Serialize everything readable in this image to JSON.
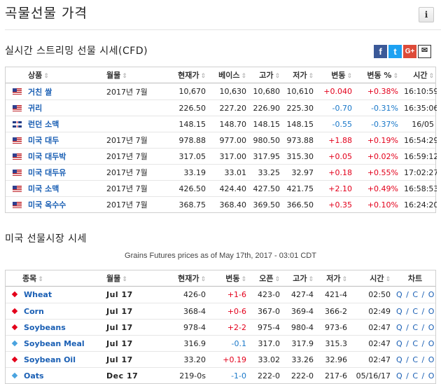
{
  "page": {
    "title": "곡물선물 가격",
    "info_label": "i"
  },
  "cfd": {
    "title": "실시간 스트리밍 선물 시세(CFD)",
    "share_icons": [
      "facebook-icon",
      "twitter-icon",
      "google-plus-icon",
      "email-icon"
    ],
    "share_glyphs": {
      "facebook": "f",
      "twitter": "t",
      "google": "G+",
      "email": "✉"
    },
    "columns": [
      "상품",
      "월물",
      "현재가",
      "베이스",
      "고가",
      "저가",
      "변동",
      "변동 %",
      "시간"
    ],
    "rows": [
      {
        "flag": "us",
        "name": "거친 쌀",
        "month": "2017년 7월",
        "last": "10,670",
        "base": "10,630",
        "high": "10,680",
        "low": "10,610",
        "chg": "+0.040",
        "pct": "+0.38%",
        "time": "16:10:59",
        "dir": "up"
      },
      {
        "flag": "us",
        "name": "귀리",
        "month": "",
        "last": "226.50",
        "base": "227.20",
        "high": "226.90",
        "low": "225.30",
        "chg": "-0.70",
        "pct": "-0.31%",
        "time": "16:35:06",
        "dir": "down"
      },
      {
        "flag": "uk",
        "name": "런던 소맥",
        "month": "",
        "last": "148.15",
        "base": "148.70",
        "high": "148.15",
        "low": "148.15",
        "chg": "-0.55",
        "pct": "-0.37%",
        "time": "16/05",
        "dir": "down"
      },
      {
        "flag": "us",
        "name": "미국 대두",
        "month": "2017년 7월",
        "last": "978.88",
        "base": "977.00",
        "high": "980.50",
        "low": "973.88",
        "chg": "+1.88",
        "pct": "+0.19%",
        "time": "16:54:29",
        "dir": "up"
      },
      {
        "flag": "us",
        "name": "미국 대두박",
        "month": "2017년 7월",
        "last": "317.05",
        "base": "317.00",
        "high": "317.95",
        "low": "315.30",
        "chg": "+0.05",
        "pct": "+0.02%",
        "time": "16:59:12",
        "dir": "up"
      },
      {
        "flag": "us",
        "name": "미국 대두유",
        "month": "2017년 7월",
        "last": "33.19",
        "base": "33.01",
        "high": "33.25",
        "low": "32.97",
        "chg": "+0.18",
        "pct": "+0.55%",
        "time": "17:02:27",
        "dir": "up"
      },
      {
        "flag": "us",
        "name": "미국 소맥",
        "month": "2017년 7월",
        "last": "426.50",
        "base": "424.40",
        "high": "427.50",
        "low": "421.75",
        "chg": "+2.10",
        "pct": "+0.49%",
        "time": "16:58:53",
        "dir": "up"
      },
      {
        "flag": "us",
        "name": "미국 옥수수",
        "month": "2017년 7월",
        "last": "368.75",
        "base": "368.40",
        "high": "369.50",
        "low": "366.50",
        "chg": "+0.35",
        "pct": "+0.10%",
        "time": "16:24:20",
        "dir": "up"
      }
    ]
  },
  "us_futures": {
    "title": "미국 선물시장 시세",
    "as_of": "Grains Futures prices as of May 17th, 2017 - 03:01 CDT",
    "columns": [
      "종목",
      "월물",
      "현재가",
      "변동",
      "오픈",
      "고가",
      "저가",
      "시간",
      "차트"
    ],
    "chart_links": "Q / C / O",
    "rows": [
      {
        "name": "Wheat",
        "month": "Jul 17",
        "last": "426-0",
        "chg": "+1-6",
        "open": "423-0",
        "high": "427-4",
        "low": "421-4",
        "time": "02:50",
        "dir": "up"
      },
      {
        "name": "Corn",
        "month": "Jul 17",
        "last": "368-4",
        "chg": "+0-6",
        "open": "367-0",
        "high": "369-4",
        "low": "366-2",
        "time": "02:49",
        "dir": "up"
      },
      {
        "name": "Soybeans",
        "month": "Jul 17",
        "last": "978-4",
        "chg": "+2-2",
        "open": "975-4",
        "high": "980-4",
        "low": "973-6",
        "time": "02:47",
        "dir": "up"
      },
      {
        "name": "Soybean Meal",
        "month": "Jul 17",
        "last": "316.9",
        "chg": "-0.1",
        "open": "317.0",
        "high": "317.9",
        "low": "315.3",
        "time": "02:47",
        "dir": "down"
      },
      {
        "name": "Soybean Oil",
        "month": "Jul 17",
        "last": "33.20",
        "chg": "+0.19",
        "open": "33.02",
        "high": "33.26",
        "low": "32.96",
        "time": "02:47",
        "dir": "up"
      },
      {
        "name": "Oats",
        "month": "Dec 17",
        "last": "219-0s",
        "chg": "-1-0",
        "open": "222-0",
        "high": "222-0",
        "low": "217-6",
        "time": "05/16/17",
        "dir": "down"
      }
    ]
  },
  "colors": {
    "up": "#e3001b",
    "down": "#1a78c9",
    "link": "#1a5fb4"
  }
}
